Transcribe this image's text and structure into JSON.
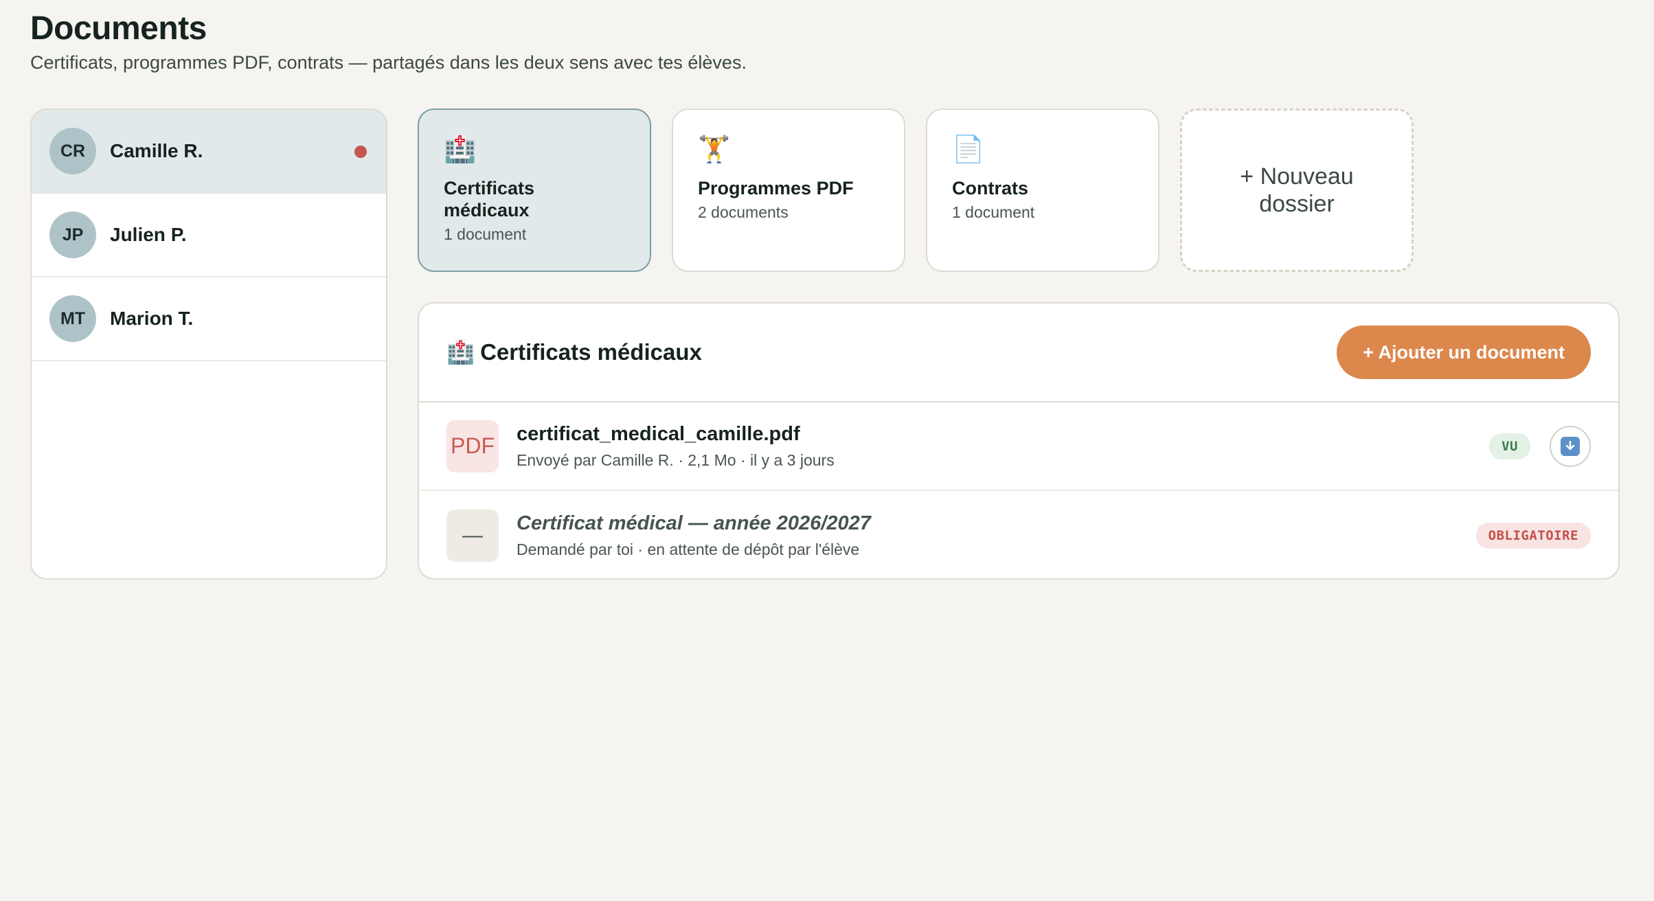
{
  "header": {
    "title": "Documents",
    "subtitle": "Certificats, programmes PDF, contrats — partagés dans les deux sens avec tes élèves."
  },
  "students": [
    {
      "initials": "CR",
      "name": "Camille R.",
      "active": true,
      "unread": true
    },
    {
      "initials": "JP",
      "name": "Julien P.",
      "active": false,
      "unread": false
    },
    {
      "initials": "MT",
      "name": "Marion T.",
      "active": false,
      "unread": false
    }
  ],
  "folders": [
    {
      "icon": "🏥",
      "icon_name": "hospital-icon",
      "name": "Certificats médicaux",
      "count": "1 document",
      "active": true
    },
    {
      "icon": "🏋️",
      "icon_name": "weightlifter-icon",
      "name": "Programmes PDF",
      "count": "2 documents",
      "active": false
    },
    {
      "icon": "📄",
      "icon_name": "document-icon",
      "name": "Contrats",
      "count": "1 document",
      "active": false
    }
  ],
  "new_folder_label": "+ Nouveau dossier",
  "panel": {
    "icon": "🏥",
    "title": "Certificats médicaux",
    "add_button_label": "+ Ajouter un document"
  },
  "documents": [
    {
      "thumb": "PDF",
      "name": "certificat_medical_camille.pdf",
      "meta": "Envoyé par Camille R. · 2,1 Mo · il y a 3 jours",
      "badge": "VU"
    },
    {
      "thumb": "—",
      "name": "Certificat médical — année 2026/2027",
      "meta": "Demandé par toi · en attente de dépôt par l'élève",
      "badge": "OBLIGATOIRE"
    }
  ],
  "colors": {
    "accent": "#dc874c",
    "active_bg": "#e1e9eb",
    "unread_dot": "#c55652",
    "seen_badge": "#3d7a4c",
    "required_badge": "#c2504b"
  }
}
